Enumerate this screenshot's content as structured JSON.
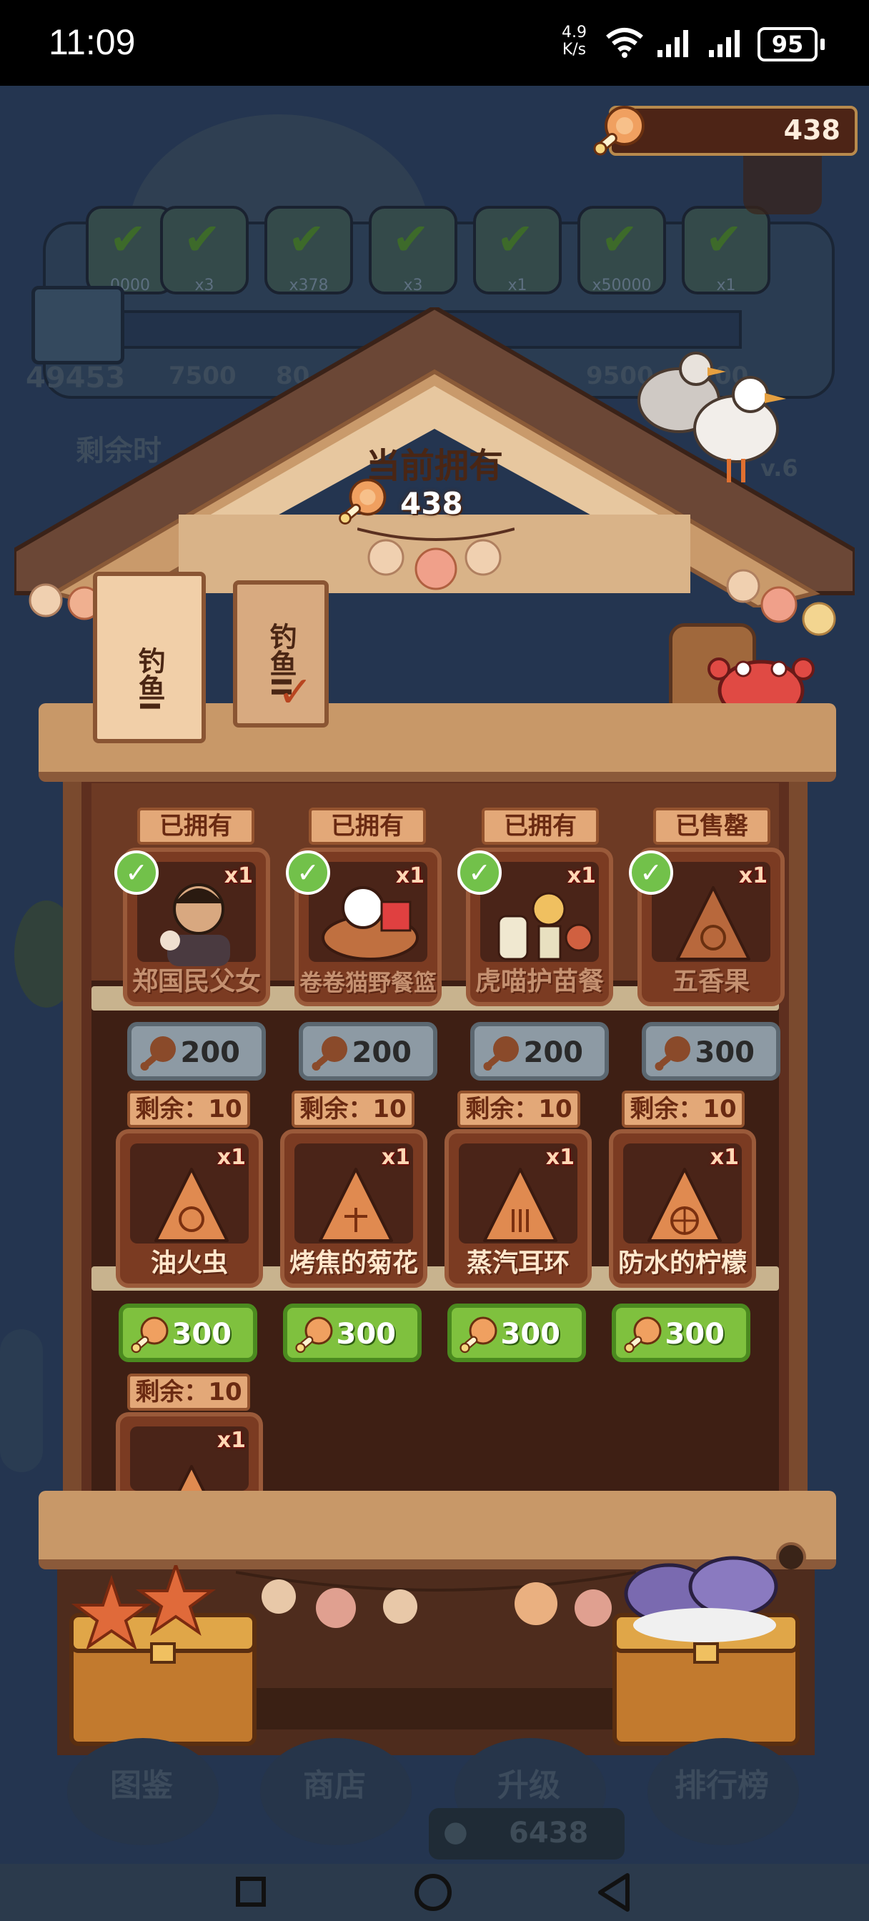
{
  "status_bar": {
    "time": "11:09",
    "net_speed_value": "4.9",
    "net_speed_unit": "K/s",
    "battery": "95"
  },
  "currency": {
    "top_amount": "438",
    "icon": "drumstick-icon"
  },
  "background": {
    "reward_counts": [
      "0000",
      "x3",
      "x378",
      "x3",
      "x1",
      "x50000",
      "x1"
    ],
    "progress_left_value": "49453",
    "progress_ticks": [
      "7500",
      "80",
      "9500",
      "00"
    ],
    "remaining_label": "剩余时",
    "level_label": "v.6",
    "bottom_currency": "6438"
  },
  "shop": {
    "title": "当前拥有",
    "owned_amount": "438",
    "tabs": [
      {
        "label": "钓鱼I",
        "selected": true
      },
      {
        "label": "钓鱼II",
        "selected": false
      }
    ],
    "row1": [
      {
        "tag": "已拥有",
        "name": "郑国民父女",
        "qty": "x1",
        "price": "200",
        "owned": true,
        "art": "portrait"
      },
      {
        "tag": "已拥有",
        "name": "卷卷猫野餐篮",
        "qty": "x1",
        "price": "200",
        "owned": true,
        "art": "basket"
      },
      {
        "tag": "已拥有",
        "name": "虎喵护苗餐",
        "qty": "x1",
        "price": "200",
        "owned": true,
        "art": "meal"
      },
      {
        "tag": "已售罄",
        "name": "五香果",
        "qty": "x1",
        "price": "300",
        "owned": true,
        "art": "fruit"
      }
    ],
    "row2": [
      {
        "tag": "剩余：10",
        "name": "油火虫",
        "qty": "x1",
        "price": "300"
      },
      {
        "tag": "剩余：10",
        "name": "烤焦的菊花",
        "qty": "x1",
        "price": "300"
      },
      {
        "tag": "剩余：10",
        "name": "蒸汽耳环",
        "qty": "x1",
        "price": "300"
      },
      {
        "tag": "剩余：10",
        "name": "防水的柠檬",
        "qty": "x1",
        "price": "300"
      }
    ],
    "row3": [
      {
        "tag": "剩余：10",
        "qty": "x1"
      }
    ]
  },
  "bottom_menu": [
    "图鉴",
    "商店",
    "升级",
    "排行榜"
  ],
  "colors": {
    "owned_check": "#72c14a",
    "buy_button": "#7fc13e",
    "disabled_button": "#8d9aa4"
  }
}
